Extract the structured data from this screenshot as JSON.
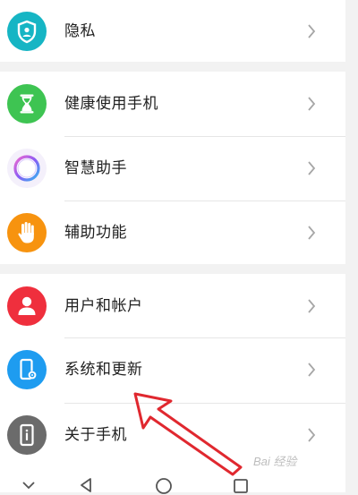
{
  "items": [
    {
      "label": "隐私",
      "icon": "privacy-shield-icon",
      "color": "#16b5c4"
    },
    {
      "label": "健康使用手机",
      "icon": "hourglass-icon",
      "color": "#3ec452"
    },
    {
      "label": "智慧助手",
      "icon": "smart-assistant-ring-icon",
      "color": "#9a6cf0"
    },
    {
      "label": "辅助功能",
      "icon": "hand-icon",
      "color": "#f7930f"
    },
    {
      "label": "用户和帐户",
      "icon": "user-icon",
      "color": "#ef2f3d"
    },
    {
      "label": "系统和更新",
      "icon": "system-update-phone-icon",
      "color": "#1e9cf0"
    },
    {
      "label": "关于手机",
      "icon": "about-phone-icon",
      "color": "#6b6b6b"
    }
  ],
  "watermark": "Bai 经验",
  "annotation_color": "#e0282f",
  "navbar": [
    "chevron-down-icon",
    "back-icon",
    "home-icon",
    "recents-icon"
  ]
}
